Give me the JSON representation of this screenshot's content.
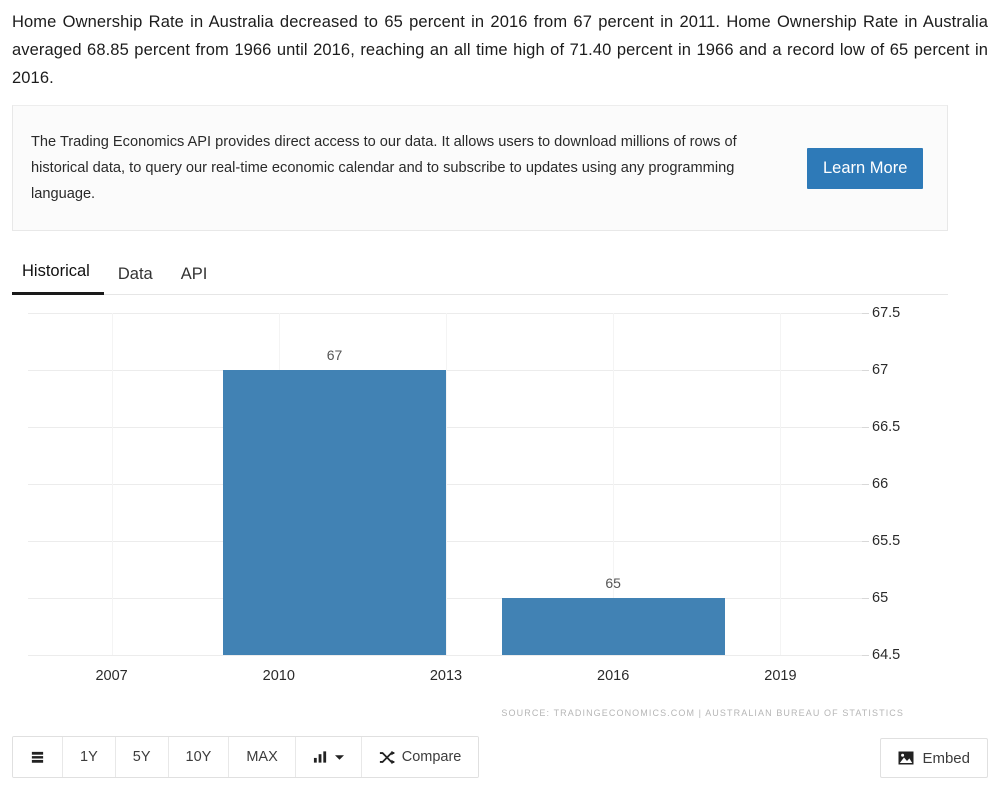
{
  "intro": {
    "paragraph": "Home Ownership Rate in Australia decreased to 65 percent in 2016 from 67 percent in 2011. Home Ownership Rate in Australia averaged 68.85 percent from 1966 until 2016, reaching an all time high of 71.40 percent in 1966 and a record low of 65 percent in 2016."
  },
  "api_promo": {
    "text": "The Trading Economics API provides direct access to our data. It allows users to download millions of rows of historical data, to query our real-time economic calendar and to subscribe to updates using any programming language.",
    "button_label": "Learn More",
    "button_color": "#2e7ab8"
  },
  "tabs": [
    {
      "label": "Historical",
      "active": true
    },
    {
      "label": "Data",
      "active": false
    },
    {
      "label": "API",
      "active": false
    }
  ],
  "chart_data": {
    "type": "bar",
    "title": "",
    "xlabel": "",
    "ylabel": "",
    "categories": [
      "2011",
      "2016"
    ],
    "values": [
      67,
      65
    ],
    "value_labels": [
      "67",
      "65"
    ],
    "ylim": [
      64.5,
      67.5
    ],
    "yticks": [
      "67.5",
      "67",
      "66.5",
      "66",
      "65.5",
      "65",
      "64.5"
    ],
    "ytick_values": [
      67.5,
      67,
      66.5,
      66,
      65.5,
      65,
      64.5
    ],
    "xticks": [
      "2007",
      "2010",
      "2013",
      "2016",
      "2019"
    ],
    "xtick_values": [
      2007,
      2010,
      2013,
      2016,
      2019
    ],
    "xlim": [
      2005.5,
      2020.5
    ],
    "grid": true,
    "legend": false,
    "series_color": "#4182b4",
    "source": "SOURCE: TRADINGECONOMICS.COM  |  AUSTRALIAN BUREAU OF STATISTICS"
  },
  "toolbar": {
    "buttons": [
      {
        "label": "",
        "icon": "list-icon"
      },
      {
        "label": "1Y",
        "icon": ""
      },
      {
        "label": "5Y",
        "icon": ""
      },
      {
        "label": "10Y",
        "icon": ""
      },
      {
        "label": "MAX",
        "icon": ""
      },
      {
        "label": "",
        "icon": "bar-chart-caret-icon"
      },
      {
        "label": "Compare",
        "icon": "shuffle-icon"
      }
    ],
    "embed_label": "Embed"
  }
}
